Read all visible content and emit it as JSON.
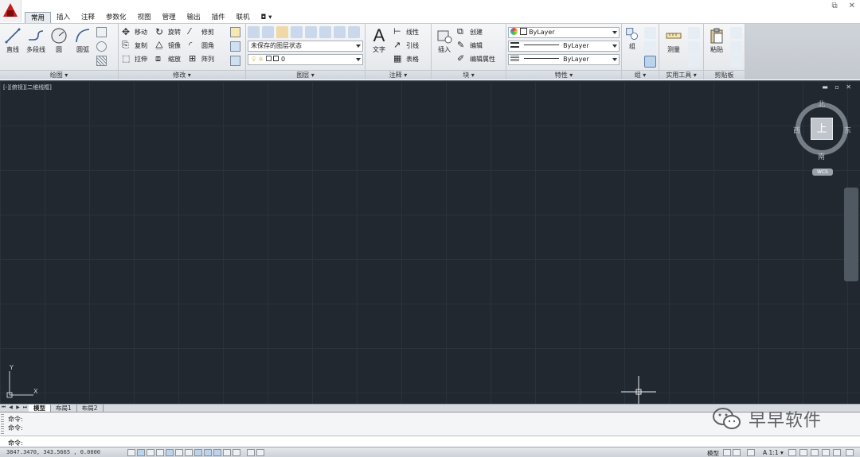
{
  "app": {
    "logo_label": "A"
  },
  "window_controls": [
    "⧉",
    "✕"
  ],
  "tabs": [
    "常用",
    "插入",
    "注释",
    "参数化",
    "视图",
    "管理",
    "输出",
    "插件",
    "联机",
    "◘ ▾"
  ],
  "active_tab": "常用",
  "ribbon": {
    "draw": {
      "title": "绘图 ▾",
      "line": "直线",
      "polyline": "多段线",
      "circle": "圆",
      "arc": "圆弧"
    },
    "modify": {
      "title": "修改 ▾",
      "move": "移动",
      "rotate": "旋转",
      "trim": "修剪",
      "copy": "复制",
      "mirror": "镜像",
      "fillet": "圆角",
      "stretch": "拉伸",
      "scale": "缩放",
      "array": "阵列"
    },
    "layers": {
      "title": "图层 ▾",
      "layer_state": "未保存的图层状态",
      "current_layer": "0"
    },
    "annotation": {
      "title": "注释 ▾",
      "text": "文字",
      "linear": "线性",
      "leader": "引线",
      "table": "表格"
    },
    "block": {
      "title": "块 ▾",
      "insert": "插入",
      "create": "创建",
      "edit": "编辑",
      "edit_attributes": "编辑属性"
    },
    "properties": {
      "title": "特性 ▾",
      "color": "ByLayer",
      "linetype": "ByLayer",
      "lineweight": "ByLayer"
    },
    "groups": {
      "title": "组 ▾",
      "group": "组"
    },
    "utilities": {
      "title": "实用工具 ▾",
      "measure": "测量"
    },
    "clipboard": {
      "title": "剪贴板",
      "paste": "粘贴"
    }
  },
  "viewport": {
    "label": "[-][俯视][二维线框]",
    "controls": "▬ ▫ ✕"
  },
  "viewcube": {
    "face": "上",
    "north": "北",
    "south": "南",
    "east": "东",
    "west": "西",
    "wcs": "WCS"
  },
  "ucs": {
    "x": "X",
    "y": "Y"
  },
  "layout_tabs": [
    "模型",
    "布局1",
    "布局2"
  ],
  "command": {
    "history": [
      "命令:",
      "命令:"
    ],
    "prompt": "命令:"
  },
  "watermark": "早早软件",
  "status": {
    "coords": "3847.3470, 343.5665 , 0.0000",
    "model": "模型",
    "scale": "A 1:1 ▾"
  }
}
